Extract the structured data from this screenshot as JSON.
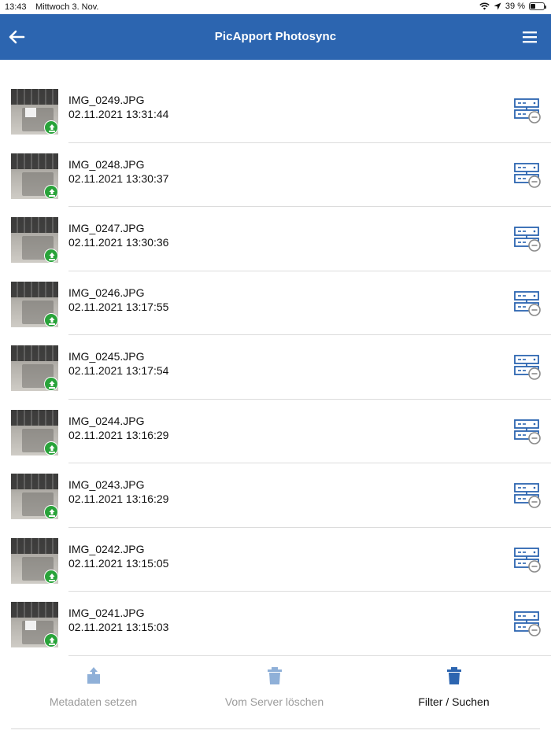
{
  "status_bar": {
    "time": "13:43",
    "date": "Mittwoch 3. Nov.",
    "battery": "39 %"
  },
  "header": {
    "title": "PicApport Photosync",
    "back_icon": "arrow-left-icon",
    "menu_icon": "hamburger-menu-icon",
    "color": "#2c65b0"
  },
  "photos": [
    {
      "name": "IMG_0249.JPG",
      "date": "02.11.2021 13:31:44"
    },
    {
      "name": "IMG_0248.JPG",
      "date": "02.11.2021 13:30:37"
    },
    {
      "name": "IMG_0247.JPG",
      "date": "02.11.2021 13:30:36"
    },
    {
      "name": "IMG_0246.JPG",
      "date": "02.11.2021 13:17:55"
    },
    {
      "name": "IMG_0245.JPG",
      "date": "02.11.2021 13:17:54"
    },
    {
      "name": "IMG_0244.JPG",
      "date": "02.11.2021 13:16:29"
    },
    {
      "name": "IMG_0243.JPG",
      "date": "02.11.2021 13:16:29"
    },
    {
      "name": "IMG_0242.JPG",
      "date": "02.11.2021 13:15:05"
    },
    {
      "name": "IMG_0241.JPG",
      "date": "02.11.2021 13:15:03"
    }
  ],
  "toolbar": {
    "set_metadata_label": "Metadaten setzen",
    "delete_server_label": "Vom Server löschen",
    "filter_label": "Filter / Suchen"
  },
  "colors": {
    "accent": "#2c65b0",
    "upload_badge": "#29a33a",
    "disabled": "#9b9b9b"
  }
}
